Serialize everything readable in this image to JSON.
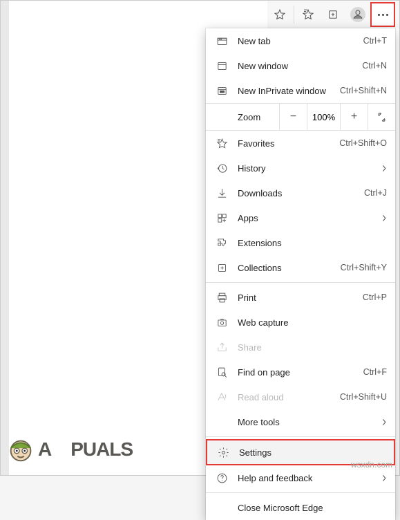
{
  "toolbar": {
    "icons": {
      "star": "favorite-this-page-icon",
      "favorites": "favorites-icon",
      "collections": "collections-icon",
      "profile": "profile-icon",
      "more": "more-menu-icon"
    }
  },
  "menu": {
    "new_tab": {
      "label": "New tab",
      "shortcut": "Ctrl+T"
    },
    "new_window": {
      "label": "New window",
      "shortcut": "Ctrl+N"
    },
    "new_inprivate": {
      "label": "New InPrivate window",
      "shortcut": "Ctrl+Shift+N"
    },
    "zoom": {
      "label": "Zoom",
      "percent": "100%"
    },
    "favorites": {
      "label": "Favorites",
      "shortcut": "Ctrl+Shift+O"
    },
    "history": {
      "label": "History"
    },
    "downloads": {
      "label": "Downloads",
      "shortcut": "Ctrl+J"
    },
    "apps": {
      "label": "Apps"
    },
    "extensions": {
      "label": "Extensions"
    },
    "collections": {
      "label": "Collections",
      "shortcut": "Ctrl+Shift+Y"
    },
    "print": {
      "label": "Print",
      "shortcut": "Ctrl+P"
    },
    "web_capture": {
      "label": "Web capture"
    },
    "share": {
      "label": "Share"
    },
    "find": {
      "label": "Find on page",
      "shortcut": "Ctrl+F"
    },
    "read_aloud": {
      "label": "Read aloud",
      "shortcut": "Ctrl+Shift+U"
    },
    "more_tools": {
      "label": "More tools"
    },
    "settings": {
      "label": "Settings"
    },
    "help": {
      "label": "Help and feedback"
    },
    "close": {
      "label": "Close Microsoft Edge"
    }
  },
  "watermark": {
    "brand_left": "A",
    "brand_right": "PUALS",
    "url": "wsxdn.com"
  }
}
